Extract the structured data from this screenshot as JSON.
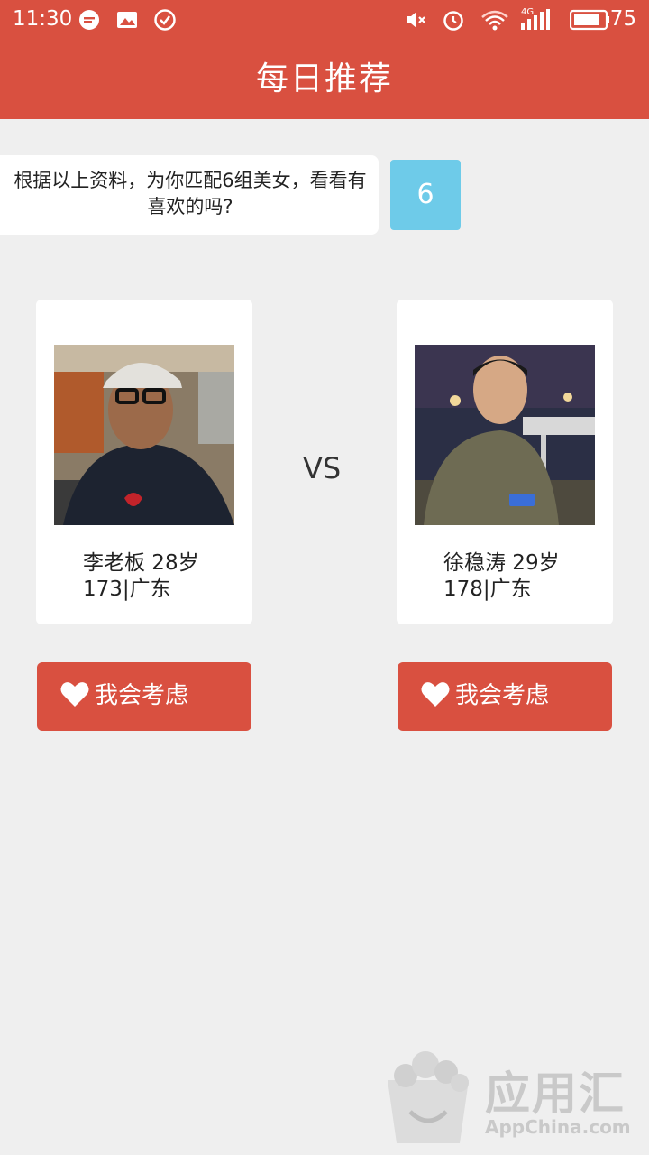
{
  "status_bar": {
    "time": "11:30",
    "network": "4G",
    "battery": "75",
    "icons": [
      "message-icon",
      "image-icon",
      "check-icon",
      "mute-icon",
      "alarm-icon",
      "wifi-icon",
      "signal-icon",
      "battery-icon"
    ]
  },
  "header": {
    "title": "每日推荐"
  },
  "prompt": {
    "text": "根据以上资料，为你匹配6组美女，看看有喜欢的吗?",
    "count": "6"
  },
  "vs_label": "VS",
  "profiles": [
    {
      "name_age": "李老板 28岁",
      "details": "173|广东",
      "button_label": "我会考虑"
    },
    {
      "name_age": "徐稳涛 29岁",
      "details": "178|广东",
      "button_label": "我会考虑"
    }
  ],
  "watermark": {
    "brand": "应用汇",
    "url": "AppChina.com"
  },
  "colors": {
    "primary": "#d95040",
    "badge": "#6ecbe9",
    "background": "#efefef",
    "card": "#ffffff"
  }
}
